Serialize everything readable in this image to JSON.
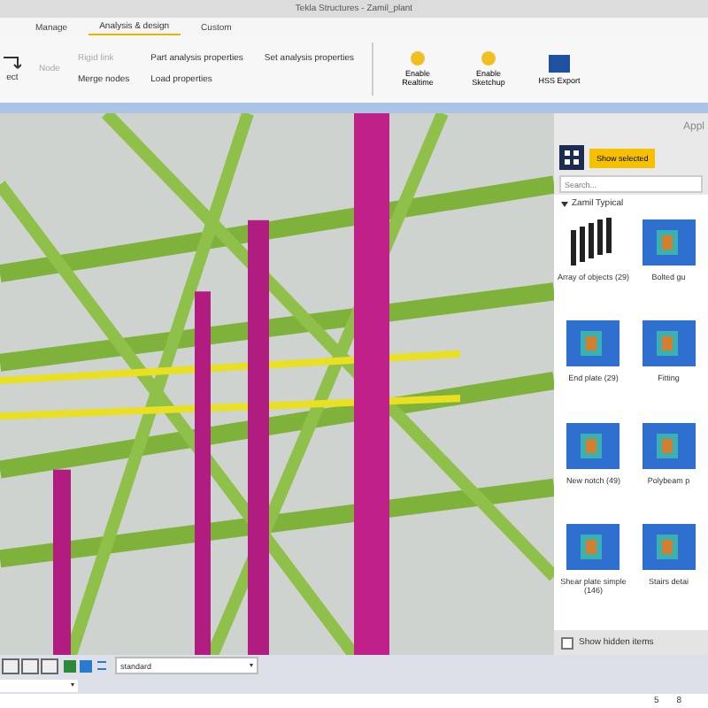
{
  "window": {
    "title": "Tekla Structures - Zamil_plant"
  },
  "tabs": [
    {
      "label": "Manage",
      "selected": false
    },
    {
      "label": "Analysis & design",
      "selected": true
    },
    {
      "label": "Custom",
      "selected": false
    }
  ],
  "ribbon": {
    "left_cut_label": "ect",
    "small_buttons": [
      {
        "label": "Rigid link",
        "disabled": true
      },
      {
        "label": "Merge nodes",
        "disabled": false
      },
      {
        "label": "Part analysis properties",
        "disabled": false
      },
      {
        "label": "Load properties",
        "disabled": false
      },
      {
        "label": "Set analysis properties",
        "disabled": false
      }
    ],
    "node_button": {
      "label": "Node",
      "disabled": true
    },
    "large_buttons": [
      {
        "label": "Enable Realtime"
      },
      {
        "label": "Enable Sketchup"
      },
      {
        "label": "HSS Export"
      }
    ]
  },
  "side_panel": {
    "title": "Appl",
    "show_selected": "Show selected",
    "search": {
      "placeholder": "Search..."
    },
    "group": {
      "label": "Zamil Typical",
      "expanded": true
    },
    "items": [
      {
        "label": "Array of objects (29)"
      },
      {
        "label": "Bolted gu"
      },
      {
        "label": "End plate (29)"
      },
      {
        "label": "Fitting"
      },
      {
        "label": "New notch (49)"
      },
      {
        "label": "Polybeam p"
      },
      {
        "label": "Shear plate simple (146)"
      },
      {
        "label": "Stairs detai"
      }
    ],
    "show_hidden_items": {
      "label": "Show hidden items",
      "checked": false
    }
  },
  "view_toolbar": {
    "view_dropdown": "standard"
  },
  "status_bar": [
    "5",
    "8"
  ]
}
